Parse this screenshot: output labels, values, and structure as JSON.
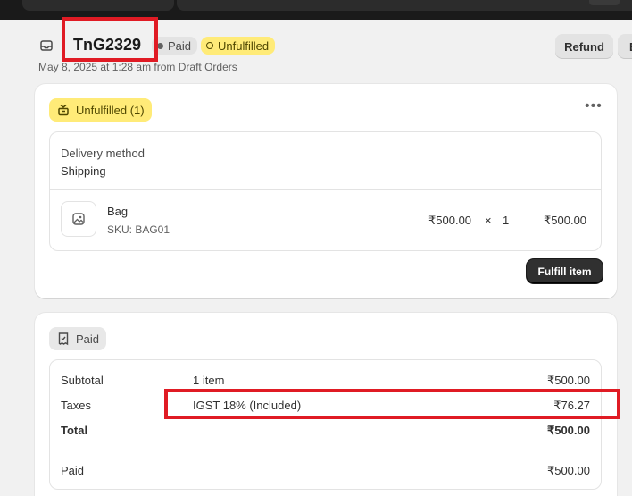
{
  "header": {
    "order_id": "TnG2329",
    "payment_status": "Paid",
    "fulfillment_status": "Unfulfilled",
    "subline": "May 8, 2025 at 1:28 am from Draft Orders",
    "refund_label": "Refund",
    "edit_label": "E"
  },
  "fulfillment_card": {
    "status_chip": "Unfulfilled (1)",
    "delivery_method_label": "Delivery method",
    "delivery_method_value": "Shipping",
    "item": {
      "name": "Bag",
      "sku": "SKU: BAG01",
      "unit_price": "₹500.00",
      "times": "×",
      "quantity": "1",
      "line_total": "₹500.00"
    },
    "fulfill_button": "Fulfill item"
  },
  "payment_card": {
    "status_chip": "Paid",
    "rows": [
      {
        "label": "Subtotal",
        "detail": "1 item",
        "amount": "₹500.00"
      },
      {
        "label": "Taxes",
        "detail": "IGST 18% (Included)",
        "amount": "₹76.27"
      },
      {
        "label": "Total",
        "detail": "",
        "amount": "₹500.00"
      },
      {
        "label": "Paid",
        "detail": "",
        "amount": "₹500.00"
      }
    ]
  },
  "colors": {
    "unfulfilled_badge": "#ffeb78",
    "paid_badge": "#e3e3e3",
    "primary_button": "#303030",
    "highlight_box": "#e01b24"
  },
  "icons": [
    "order-icon",
    "unfulfilled-box-icon",
    "more-actions-icon",
    "image-placeholder-icon",
    "receipt-icon"
  ]
}
